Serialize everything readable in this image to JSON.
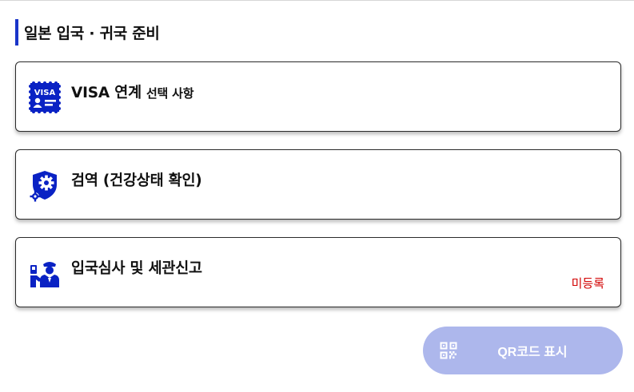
{
  "section": {
    "title": "일본 입국 · 귀국 준비"
  },
  "cards": [
    {
      "title": "VISA 연계",
      "subtitle": "선택 사항",
      "icon": "visa-card-icon"
    },
    {
      "title": "검역 (건강상태 확인)",
      "icon": "quarantine-shield-gear-icon"
    },
    {
      "title": "입국심사 및 세관신고",
      "status": "미등록",
      "icon": "immigration-officer-icon"
    }
  ],
  "qr_button": {
    "label": "QR코드 표시",
    "icon": "qr-code-icon"
  },
  "colors": {
    "accent": "#1a35c9",
    "icon_blue": "#0a22c4",
    "status_red": "#d20000",
    "qr_button_bg": "#adb7ec"
  }
}
